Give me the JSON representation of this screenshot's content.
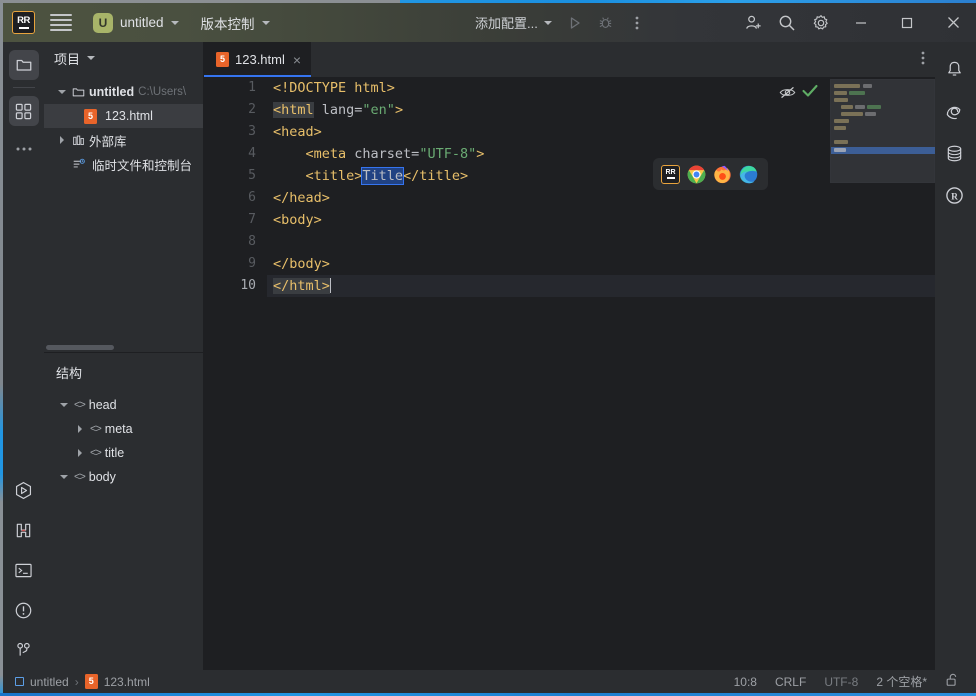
{
  "window": {
    "titlebar": {
      "app_logo": "rubymine-logo-icon",
      "menu_icon": "hamburger-menu-icon",
      "project_badge": "U",
      "project_name": "untitled",
      "vcs_label": "版本控制",
      "run_config_label": "添加配置...",
      "run_icon": "run-icon",
      "debug_icon": "debug-icon",
      "more_icon": "more-vertical-icon",
      "add_user_icon": "add-user-icon",
      "search_icon": "search-icon",
      "settings_icon": "gear-icon",
      "minimize": "minimize-icon",
      "maximize": "maximize-icon",
      "close": "close-icon"
    }
  },
  "left_rail": {
    "items": [
      {
        "name": "project",
        "icon": "folder-icon",
        "active": true
      },
      {
        "name": "plugins",
        "icon": "grid-blocks-icon",
        "active": false
      },
      {
        "name": "more-tool-windows",
        "icon": "ellipsis-icon",
        "active": false
      }
    ],
    "bottom_items": [
      {
        "name": "run",
        "icon": "run-hexagon-icon"
      },
      {
        "name": "debug",
        "icon": "debug-bug-icon"
      },
      {
        "name": "terminal",
        "icon": "terminal-icon"
      },
      {
        "name": "problems",
        "icon": "warning-circle-icon"
      },
      {
        "name": "version-control",
        "icon": "git-branch-icon"
      }
    ]
  },
  "project_panel": {
    "title": "项目",
    "tree": [
      {
        "label": "untitled",
        "suffix": "C:\\Users\\",
        "icon": "folder-icon",
        "expanded": true,
        "depth": 0,
        "bold": true
      },
      {
        "label": "123.html",
        "suffix": "",
        "icon": "html5-icon",
        "expanded": null,
        "depth": 1,
        "selected": true
      },
      {
        "label": "外部库",
        "suffix": "",
        "icon": "library-icon",
        "expanded": false,
        "depth": 0
      },
      {
        "label": "临时文件和控制台",
        "suffix": "",
        "icon": "scratches-icon",
        "expanded": null,
        "depth": 0
      }
    ]
  },
  "structure_panel": {
    "title": "结构",
    "tree": [
      {
        "label": "head",
        "depth": 0,
        "expanded": true
      },
      {
        "label": "meta",
        "depth": 1,
        "expanded": false
      },
      {
        "label": "title",
        "depth": 1,
        "expanded": false
      },
      {
        "label": "body",
        "depth": 0,
        "expanded": true
      }
    ]
  },
  "editor": {
    "tab": {
      "label": "123.html",
      "icon": "html5-icon",
      "close": "×"
    },
    "tab_more_icon": "more-vertical-icon",
    "reader_mode_icon": "eye-slash-icon",
    "inspection_icon": "checkmark-icon",
    "lines": [
      {
        "n": "1",
        "text": "<!DOCTYPE html>"
      },
      {
        "n": "2",
        "text": "<html lang=\"en\">"
      },
      {
        "n": "3",
        "text": "<head>"
      },
      {
        "n": "4",
        "text": "    <meta charset=\"UTF-8\">"
      },
      {
        "n": "5",
        "text": "    <title>Title</title>"
      },
      {
        "n": "6",
        "text": "</head>"
      },
      {
        "n": "7",
        "text": "<body>"
      },
      {
        "n": "8",
        "text": ""
      },
      {
        "n": "9",
        "text": "</body>"
      },
      {
        "n": "10",
        "text": "</html>"
      }
    ]
  },
  "browser_popup": {
    "items": [
      {
        "name": "rubymine-builtin-preview",
        "label": "RR"
      },
      {
        "name": "chrome",
        "label": ""
      },
      {
        "name": "firefox",
        "label": ""
      },
      {
        "name": "edge",
        "label": ""
      }
    ]
  },
  "right_rail": {
    "items": [
      {
        "name": "notifications",
        "icon": "bell-icon"
      },
      {
        "name": "ai-assistant",
        "icon": "spiral-icon"
      },
      {
        "name": "database",
        "icon": "database-icon"
      },
      {
        "name": "rails",
        "icon": "circled-r-icon"
      }
    ]
  },
  "statusbar": {
    "breadcrumb_project": "untitled",
    "breadcrumb_separator": "›",
    "breadcrumb_file": "123.html",
    "caret_position": "10:8",
    "line_separator": "CRLF",
    "encoding": "UTF-8",
    "indent": "2 个空格*",
    "lock_icon": "unlocked-padlock-icon"
  },
  "colors": {
    "accent_blue": "#3574f0",
    "editor_bg": "#1e1f22",
    "panel_bg": "#2b2d30",
    "tag_orange": "#e8bf6a",
    "string_green": "#6aab73",
    "html_icon": "#e8642a",
    "project_badge": "#a8b469",
    "ok_green": "#5fad65"
  }
}
